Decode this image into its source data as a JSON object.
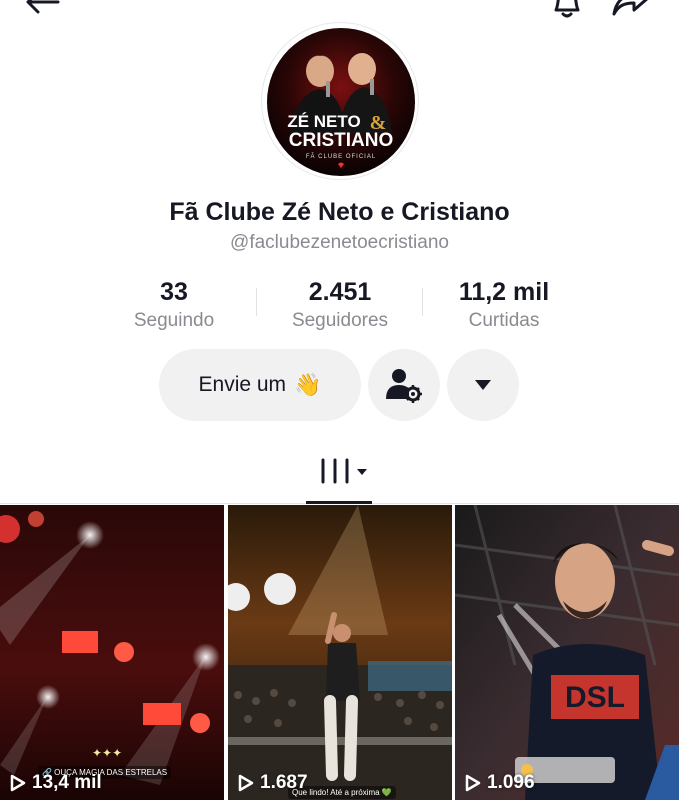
{
  "header": {
    "back_icon": "arrow-left-icon",
    "bell_icon": "bell-icon",
    "share_icon": "share-arrow-icon"
  },
  "profile": {
    "avatar_logo_line1": "ZÉ NETO",
    "avatar_logo_amp": "&",
    "avatar_logo_line2": "CRISTIANO",
    "avatar_logo_sub": "FÃ CLUBE OFICIAL",
    "display_name": "Fã Clube Zé Neto e Cristiano",
    "username": "@faclubezenetoecristiano"
  },
  "stats": [
    {
      "value": "33",
      "label": "Seguindo"
    },
    {
      "value": "2.451",
      "label": "Seguidores"
    },
    {
      "value": "11,2 mil",
      "label": "Curtidas"
    }
  ],
  "actions": {
    "message_label": "Envie um",
    "message_emoji": "👋",
    "add_friend_icon": "user-settings-icon",
    "more_icon": "caret-down-icon"
  },
  "tabs": {
    "videos_icon": "grid-columns-icon"
  },
  "videos": [
    {
      "views": "13,4 mil",
      "caption": "🔗 OUÇA MAGIA DAS ESTRELAS"
    },
    {
      "views": "1.687",
      "caption": "Que lindo! Até a próxima 💚"
    },
    {
      "views": "1.096",
      "caption": ""
    }
  ],
  "colors": {
    "text_primary": "#161823",
    "text_secondary": "#8a8b91",
    "button_bg": "#f1f1f2"
  }
}
